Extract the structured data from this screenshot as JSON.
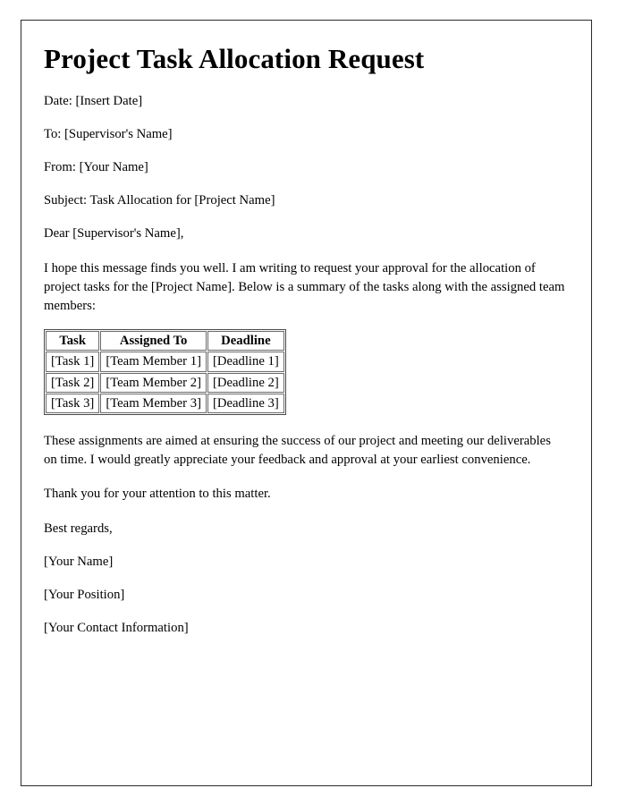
{
  "document": {
    "title": "Project Task Allocation Request",
    "header_fields": [
      {
        "key": "date",
        "text": "Date: [Insert Date]"
      },
      {
        "key": "to",
        "text": "To: [Supervisor's Name]"
      },
      {
        "key": "from",
        "text": "From: [Your Name]"
      },
      {
        "key": "subject",
        "text": "Subject: Task Allocation for [Project Name]"
      }
    ],
    "salutation": "Dear [Supervisor's Name],",
    "intro_paragraph": "I hope this message finds you well. I am writing to request your approval for the allocation of project tasks for the [Project Name]. Below is a summary of the tasks along with the assigned team members:",
    "table": {
      "columns": [
        "Task",
        "Assigned To",
        "Deadline"
      ],
      "rows": [
        [
          "[Task 1]",
          "[Team Member 1]",
          "[Deadline 1]"
        ],
        [
          "[Task 2]",
          "[Team Member 2]",
          "[Deadline 2]"
        ],
        [
          "[Task 3]",
          "[Team Member 3]",
          "[Deadline 3]"
        ]
      ]
    },
    "closing_paragraph": "These assignments are aimed at ensuring the success of our project and meeting our deliverables on time. I would greatly appreciate your feedback and approval at your earliest convenience.",
    "thanks_paragraph": "Thank you for your attention to this matter.",
    "signature": {
      "valediction": "Best regards,",
      "name": "[Your Name]",
      "position": "[Your Position]",
      "contact": "[Your Contact Information]"
    }
  },
  "style": {
    "page_background": "#ffffff",
    "text_color": "#000000",
    "frame_border_color": "#2a2a2a",
    "table_border_color": "#6b6b6b"
  }
}
